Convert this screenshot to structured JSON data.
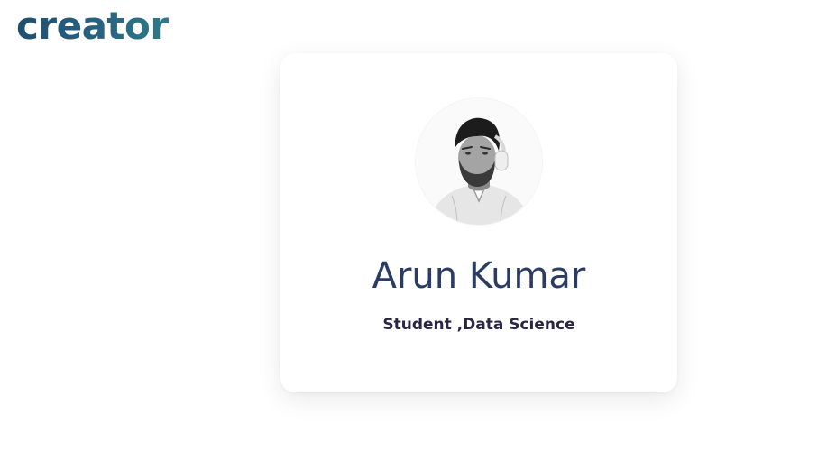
{
  "header": {
    "logo_text": "creator"
  },
  "profile": {
    "name": "Arun Kumar",
    "role": "Student ,Data Science",
    "avatar_icon": "person-photo-icon"
  },
  "colors": {
    "logo_gradient_start": "#1f4f70",
    "logo_gradient_end": "#2d7a86",
    "name_color": "#2a3b64",
    "role_color": "#2a2545",
    "background": "#ffffff"
  }
}
